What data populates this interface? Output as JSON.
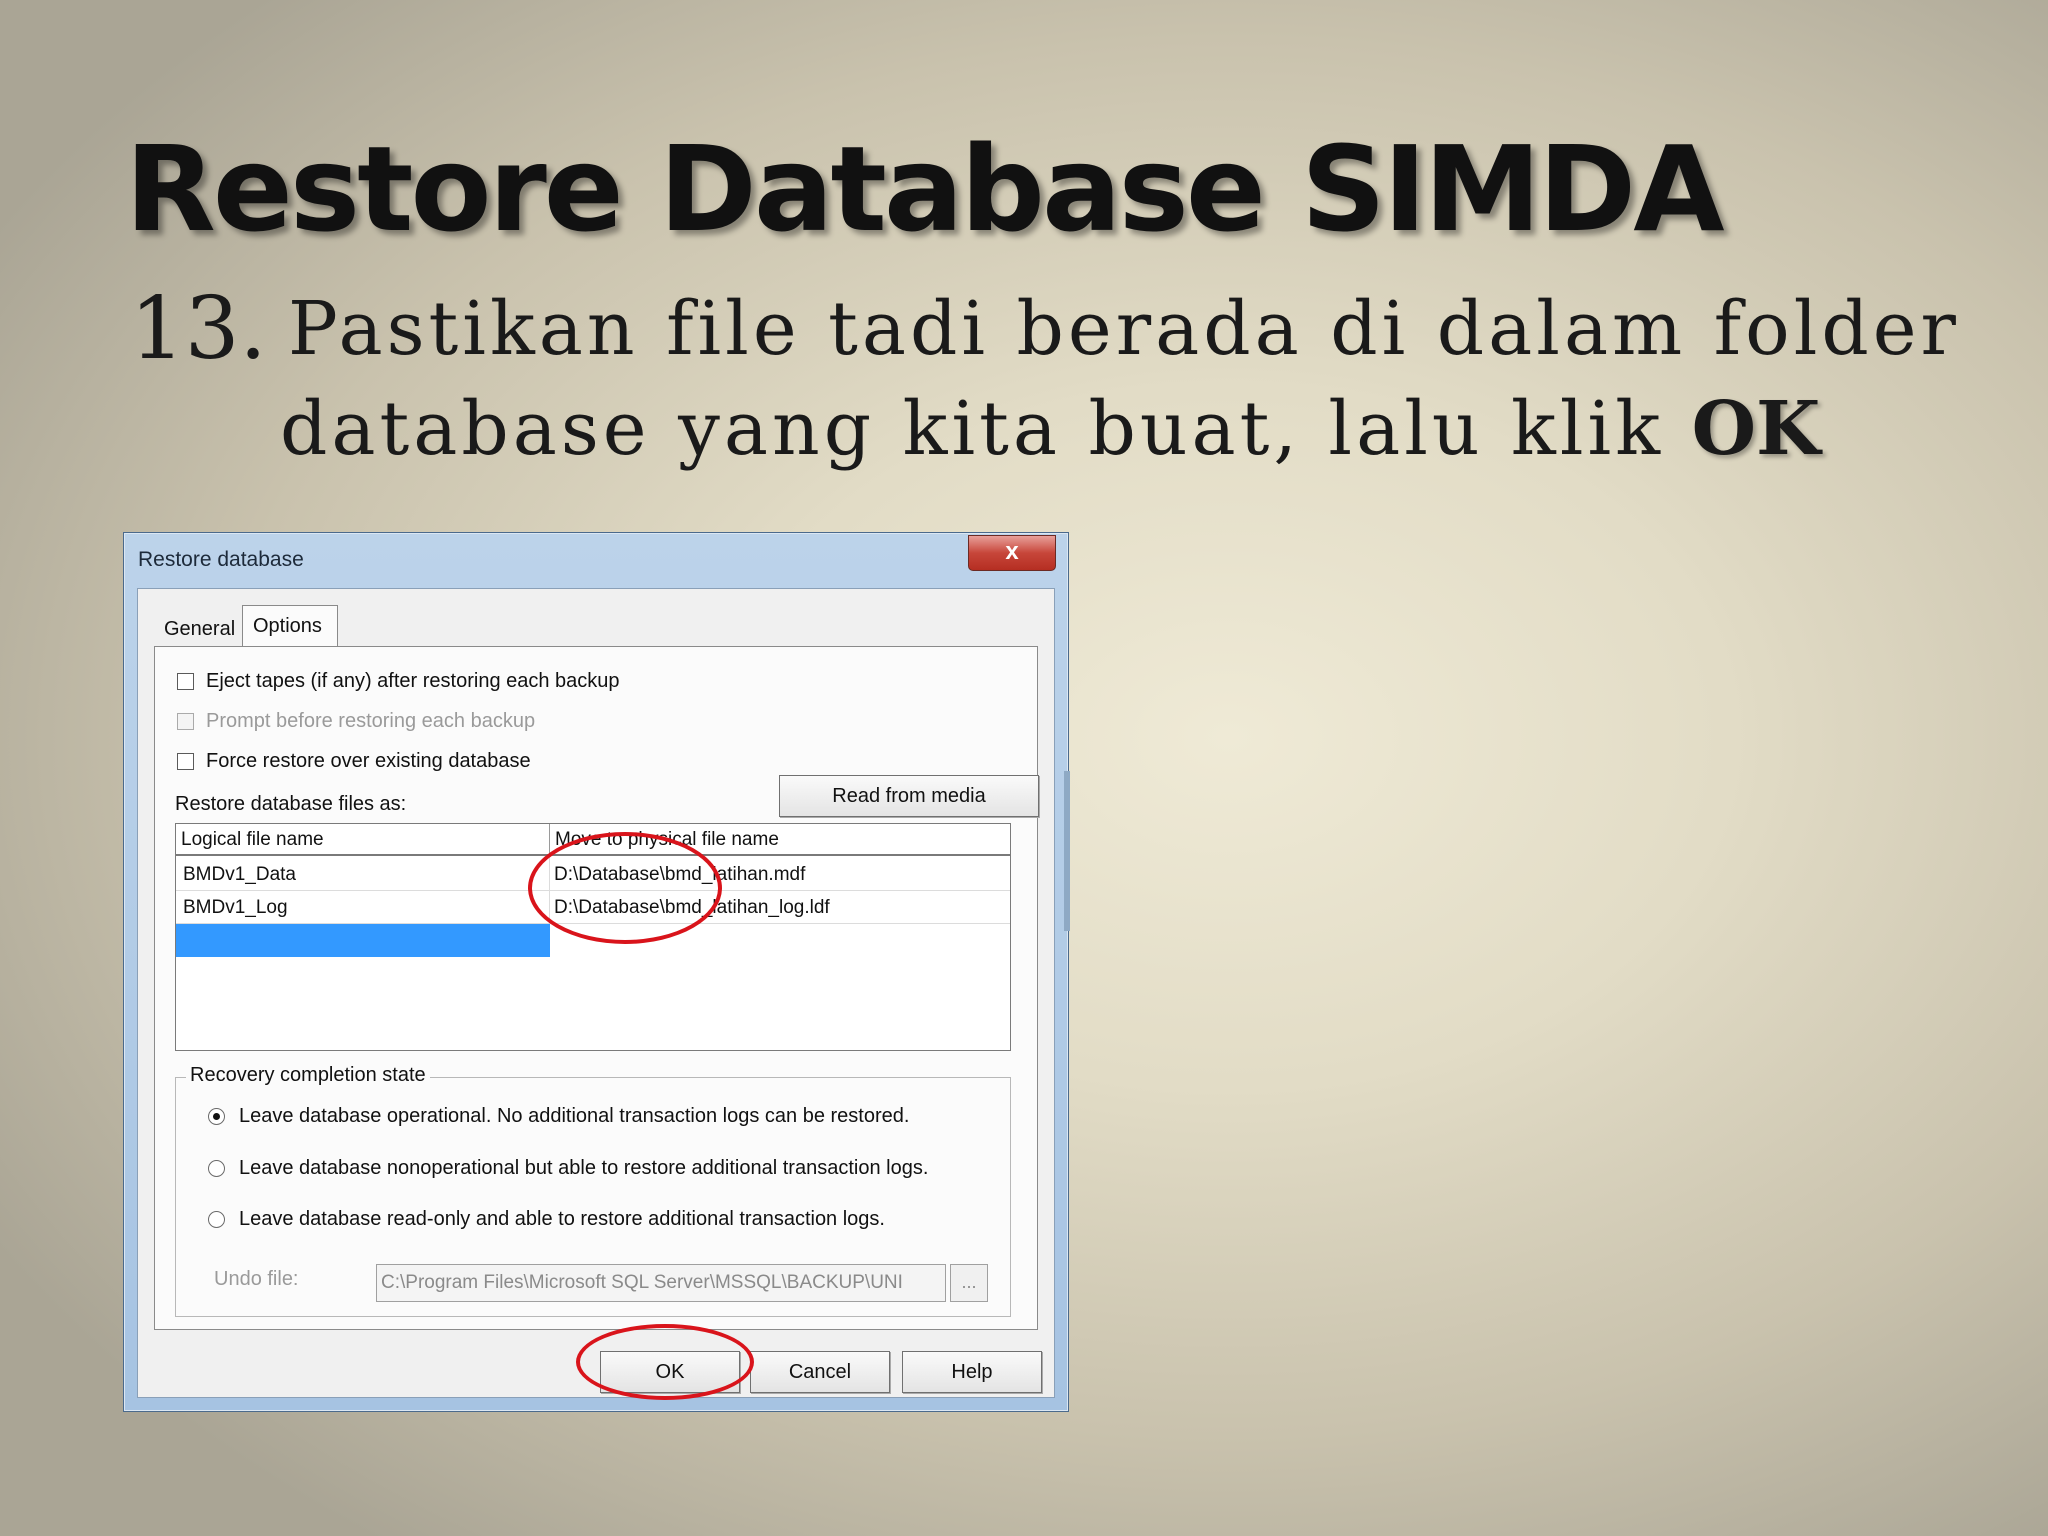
{
  "slide": {
    "title": "Restore Database SIMDA",
    "step_number": "13.",
    "step_line1": "Pastikan file tadi berada di dalam folder",
    "step_line2_text": "database yang kita buat, lalu klik ",
    "step_line2_bold": "OK"
  },
  "dialog": {
    "title": "Restore database",
    "close_label": "x",
    "tabs": {
      "general": "General",
      "options": "Options"
    },
    "checkboxes": {
      "eject": "Eject tapes (if any) after restoring each backup",
      "prompt": "Prompt before restoring each backup",
      "force": "Force restore over existing database"
    },
    "restore_files_label": "Restore database files as:",
    "read_from_media": "Read from media",
    "grid": {
      "col1": "Logical file name",
      "col2": "Move to physical file name",
      "rows": [
        {
          "logical": "BMDv1_Data",
          "physical": "D:\\Database\\bmd_latihan.mdf"
        },
        {
          "logical": "BMDv1_Log",
          "physical": "D:\\Database\\bmd_latihan_log.ldf"
        }
      ]
    },
    "recovery": {
      "title": "Recovery completion state",
      "options": [
        "Leave database operational. No additional transaction logs can be restored.",
        "Leave database nonoperational but able to restore additional transaction logs.",
        "Leave database read-only and able to restore additional transaction logs."
      ],
      "selected_index": 0,
      "undo_label": "Undo file:",
      "undo_value": "C:\\Program Files\\Microsoft SQL Server\\MSSQL\\BACKUP\\UNI",
      "browse_label": "..."
    },
    "buttons": {
      "ok": "OK",
      "cancel": "Cancel",
      "help": "Help"
    },
    "colors": {
      "annotation": "#d9141b",
      "selection": "#3399ff"
    }
  }
}
